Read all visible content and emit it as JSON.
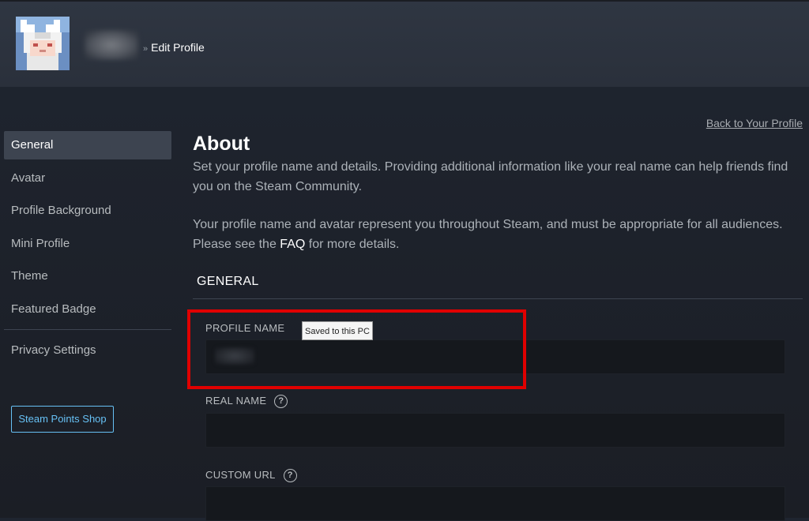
{
  "header": {
    "breadcrumb_sep": "»",
    "breadcrumb_current": "Edit Profile"
  },
  "back_link": "Back to Your Profile",
  "sidebar": {
    "items": [
      {
        "label": "General",
        "active": true
      },
      {
        "label": "Avatar"
      },
      {
        "label": "Profile Background"
      },
      {
        "label": "Mini Profile"
      },
      {
        "label": "Theme"
      },
      {
        "label": "Featured Badge"
      }
    ],
    "privacy_label": "Privacy Settings",
    "points_shop_label": "Steam Points Shop"
  },
  "about": {
    "title": "About",
    "para1": "Set your profile name and details. Providing additional information like your real name can help friends find you on the Steam Community.",
    "para2_prefix": "Your profile name and avatar represent you throughout Steam, and must be appropriate for all audiences. Please see the ",
    "para2_link": "FAQ",
    "para2_suffix": " for more details."
  },
  "general": {
    "section_title": "GENERAL",
    "profile_name_label": "PROFILE NAME",
    "profile_name_tooltip": "Saved to this PC",
    "real_name_label": "REAL NAME",
    "custom_url_label": "CUSTOM URL",
    "help_glyph": "?"
  },
  "colors": {
    "highlight_box": "#e00000",
    "accent_link": "#67c1f5"
  }
}
